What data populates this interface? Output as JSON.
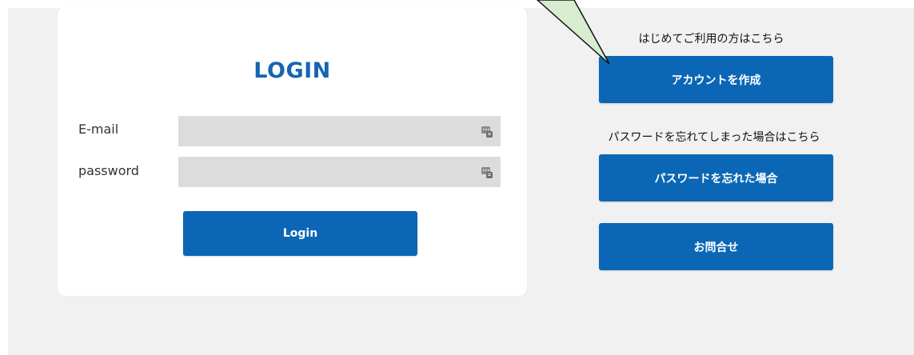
{
  "login_card": {
    "title": "LOGIN",
    "email_label": "E-mail",
    "email_value": "",
    "password_label": "password",
    "password_value": "",
    "login_button": "Login"
  },
  "side_panel": {
    "new_user_text": "はじめてご利用の方はこちら",
    "create_account_button": "アカウントを作成",
    "forgot_text": "パスワードを忘れてしまった場合はこちら",
    "forgot_button": "パスワードを忘れた場合",
    "contact_button": "お問合せ"
  },
  "icons": {
    "field_autofill": "keyboard-autofill-icon"
  },
  "colors": {
    "accent": "#0b67b5",
    "title": "#1565b0",
    "page_bg": "#f1f1f1",
    "input_bg": "#dcdcdc",
    "callout_fill": "#d8ecd0"
  }
}
